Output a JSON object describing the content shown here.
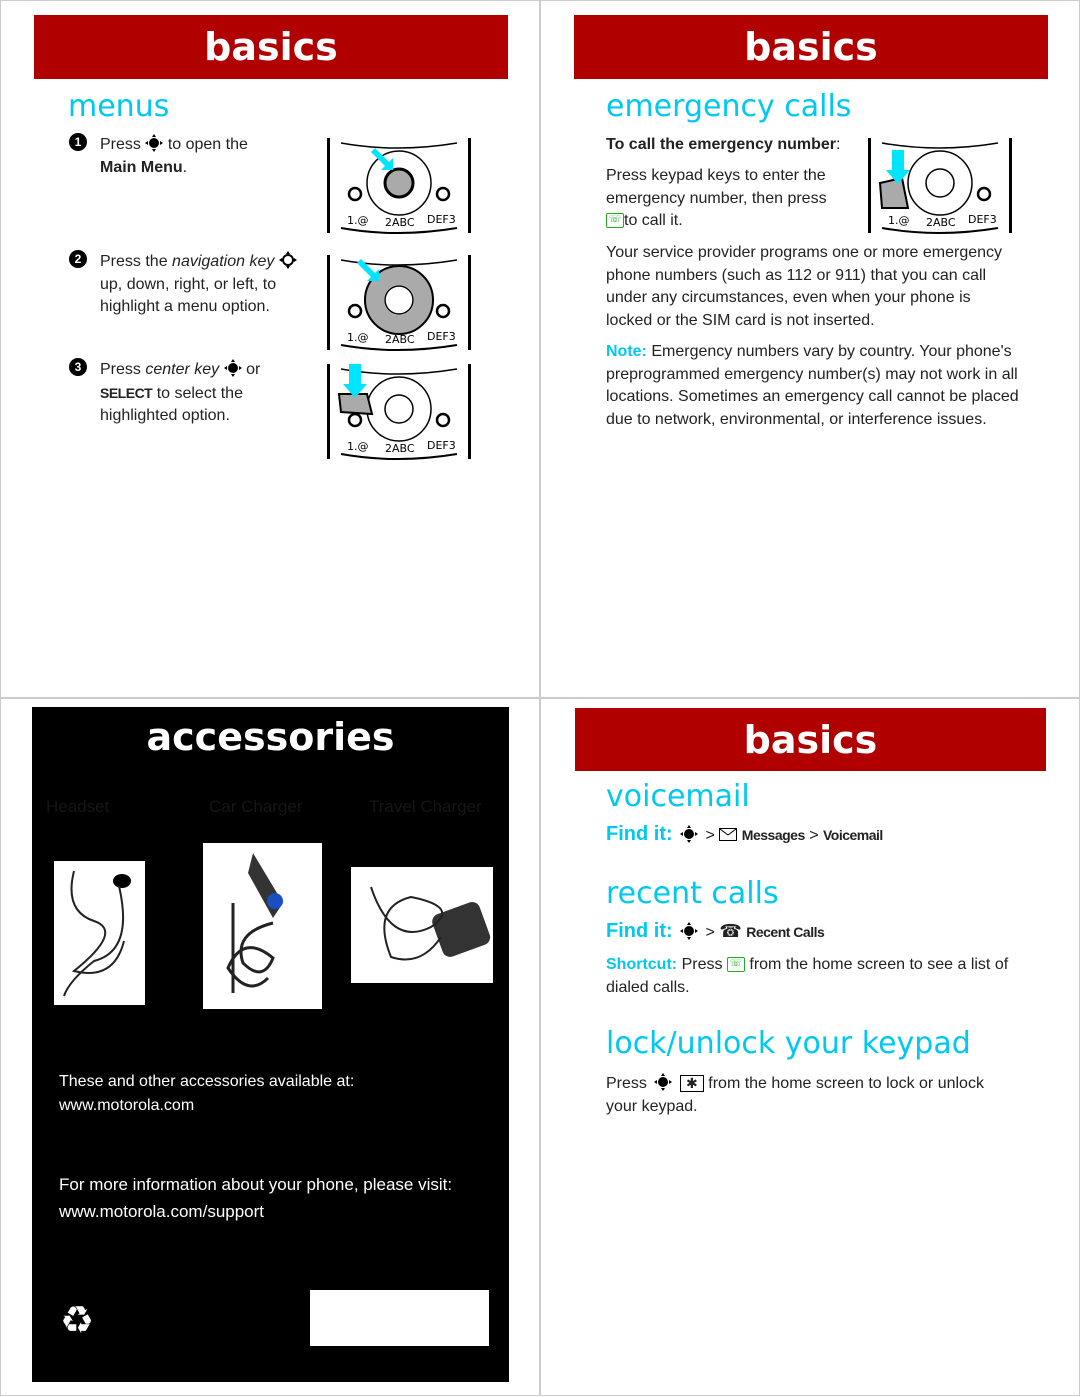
{
  "q1": {
    "header": "basics",
    "title": "menus",
    "steps": [
      {
        "num": "1",
        "pre": "Press",
        "post": "to open the",
        "bold": "Main Menu",
        "end": "."
      },
      {
        "num": "2",
        "pre": "Press the",
        "italic": "navigation key",
        "rest": "up, down, right, or left, to highlight a menu option."
      },
      {
        "num": "3",
        "pre": "Press",
        "italic": "center key",
        "or": "or",
        "select": "SELECT",
        "rest": "to select the highlighted option."
      }
    ],
    "keypad_labels": {
      "k1": "1.@",
      "k2": "2ABC",
      "k3": "DEF3"
    }
  },
  "q2": {
    "header": "basics",
    "title": "emergency calls",
    "lead": "To call the emergency number",
    "lead_end": ":",
    "p1": "Press keypad keys to enter the emergency number, then press",
    "p1_end": "to call it.",
    "p2": "Your service provider programs one or more emergency phone numbers (such as 112 or 911) that you can call under any circumstances, even when your phone is locked or the SIM card is not inserted.",
    "note_label": "Note:",
    "note": "Emergency numbers vary by country. Your phone's preprogrammed emergency number(s) may not work in all locations. Sometimes an emergency call cannot be placed due to network, environmental, or interference issues."
  },
  "q3": {
    "title": "accessories",
    "products": [
      "Headset",
      "Car Charger",
      "Travel Charger"
    ],
    "avail": "These and other accessories available at:",
    "avail_url": "www.motorola.com",
    "info": "For more information about your phone, please visit:",
    "info_url": "www.motorola.com/support",
    "recycle_icon": "recycle-icon"
  },
  "q4": {
    "header": "basics",
    "voicemail": {
      "title": "voicemail",
      "find": "Find it:",
      "gt": ">",
      "messages": "Messages",
      "gt2": ">",
      "target": "Voicemail"
    },
    "recent": {
      "title": "recent calls",
      "find": "Find it:",
      "gt": ">",
      "target": "Recent Calls",
      "shortcut_label": "Shortcut:",
      "shortcut": "Press",
      "shortcut_end": "from the home screen to see a list of dialed calls."
    },
    "lock": {
      "title": "lock/unlock your keypad",
      "pre": "Press",
      "post": "from the home screen to lock or unlock your keypad."
    }
  },
  "colors": {
    "header": "#b00000",
    "accent": "#00c8f0"
  }
}
